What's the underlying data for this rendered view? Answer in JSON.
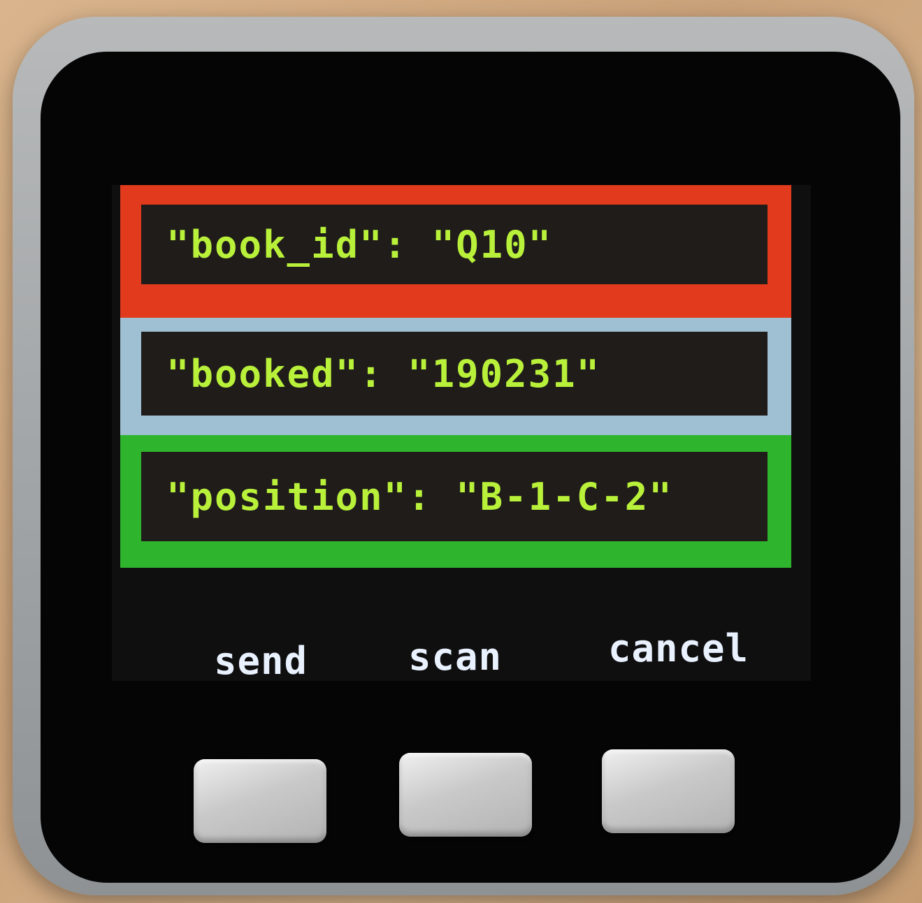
{
  "screen": {
    "rows": [
      {
        "text": "\"book_id\": \"Q10\"",
        "frame_color": "#e23a1c"
      },
      {
        "text": "\"booked\": \"190231\"",
        "frame_color": "#9fbfd2"
      },
      {
        "text": "\"position\": \"B-1-C-2\"",
        "frame_color": "#2fb52d"
      }
    ],
    "text_color": "#b8f03a",
    "buttons": {
      "send": "send",
      "scan": "scan",
      "cancel": "cancel"
    }
  }
}
